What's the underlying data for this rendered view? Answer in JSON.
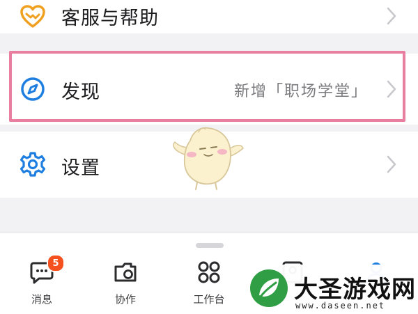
{
  "menu": {
    "help": {
      "label": "客服与帮助",
      "icon": "heart-handshake-icon",
      "color": "#f0a020"
    },
    "discover": {
      "label": "发现",
      "value": "新增「职场学堂」",
      "icon": "compass-icon",
      "color": "#1e7fe0"
    },
    "settings": {
      "label": "设置",
      "icon": "gear-icon",
      "color": "#1e7fe0"
    }
  },
  "tabbar": {
    "tabs": [
      {
        "label": "消息",
        "icon": "chat-bubble-icon",
        "badge": "5"
      },
      {
        "label": "协作",
        "icon": "collab-folder-icon"
      },
      {
        "label": "工作台",
        "icon": "grid-icon"
      },
      {
        "label": "",
        "icon": "contacts-icon"
      },
      {
        "label": "",
        "icon": "profile-icon"
      }
    ]
  },
  "watermark": {
    "title": "大圣游戏网",
    "url": "www.daseen.net"
  },
  "colors": {
    "highlight": "#e97fa0",
    "accent": "#1e7fe0",
    "badge": "#f4511e"
  }
}
